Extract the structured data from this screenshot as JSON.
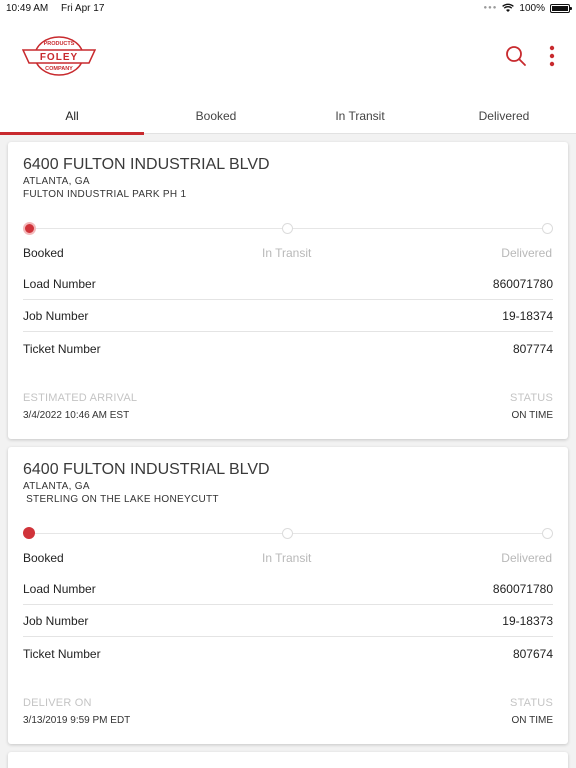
{
  "status_bar": {
    "time": "10:49 AM",
    "date": "Fri Apr 17",
    "battery": "100%"
  },
  "header": {
    "logo": {
      "top": "PRODUCTS",
      "brand": "FOLEY",
      "bottom": "COMPANY"
    },
    "accent_color": "#c82a2e"
  },
  "tabs": [
    {
      "label": "All",
      "active": true
    },
    {
      "label": "Booked"
    },
    {
      "label": "In Transit"
    },
    {
      "label": "Delivered"
    }
  ],
  "cards": [
    {
      "address": "6400 FULTON INDUSTRIAL BLVD",
      "city": "ATLANTA, GA",
      "project": "FULTON INDUSTRIAL PARK PH 1",
      "stages": [
        "Booked",
        "In Transit",
        "Delivered"
      ],
      "current_stage": "Booked",
      "rows": [
        {
          "label": "Load Number",
          "value": "860071780"
        },
        {
          "label": "Job Number",
          "value": "19-18374"
        },
        {
          "label": "Ticket Number",
          "value": "807774"
        }
      ],
      "footer": {
        "left_label": "ESTIMATED ARRIVAL",
        "left_value": "3/4/2022 10:46 AM EST",
        "right_label": "STATUS",
        "right_value": "ON TIME"
      }
    },
    {
      "address": "6400 FULTON INDUSTRIAL BLVD",
      "city": "ATLANTA, GA",
      "project": " STERLING ON THE LAKE HONEYCUTT",
      "stages": [
        "Booked",
        "In Transit",
        "Delivered"
      ],
      "current_stage": "Booked",
      "rows": [
        {
          "label": "Load Number",
          "value": "860071780"
        },
        {
          "label": "Job Number",
          "value": "19-18373"
        },
        {
          "label": "Ticket Number",
          "value": "807674"
        }
      ],
      "footer": {
        "left_label": "DELIVER ON",
        "left_value": "3/13/2019 9:59 PM EDT",
        "right_label": "STATUS",
        "right_value": "ON TIME"
      }
    }
  ]
}
